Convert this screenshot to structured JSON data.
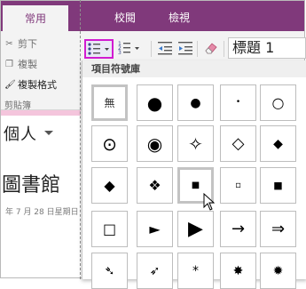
{
  "ribbon": {
    "tabs": [
      {
        "label": "常用",
        "active": true
      },
      {
        "label": "校閱",
        "active": false
      },
      {
        "label": "檢視",
        "active": false
      }
    ],
    "clipboard": {
      "cut_label": "剪下",
      "copy_label": "複製",
      "format_painter_label": "複製格式",
      "group_label": "剪貼簿"
    },
    "style_box_value": "標題 1"
  },
  "page": {
    "section_name": "個人",
    "title": "圖書館",
    "date": "年 7 月 28 日星期日"
  },
  "bullet_library": {
    "header": "項目符號庫",
    "none_label": "無",
    "rows": [
      [
        "無",
        "●",
        "●",
        "•",
        "○"
      ],
      [
        "⊙",
        "◉",
        "✧",
        "◇",
        "◆"
      ],
      [
        "◆",
        "❖",
        "■",
        "▫",
        "■"
      ],
      [
        "□",
        "►",
        "▶",
        "→",
        "⇒"
      ],
      [
        "➴",
        "➶",
        "*",
        "✸",
        "✹"
      ]
    ]
  },
  "colors": {
    "accent": "#80397b",
    "highlight_border": "#d21bd1"
  }
}
